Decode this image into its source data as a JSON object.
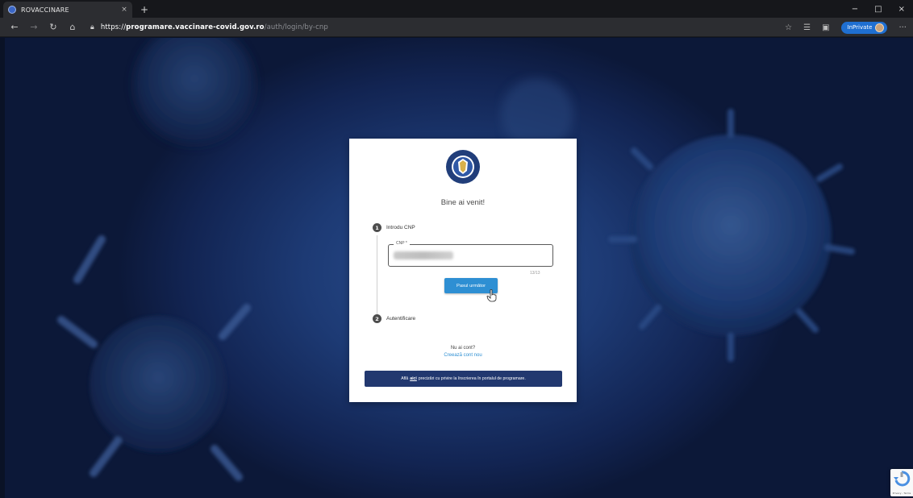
{
  "browser": {
    "tab_title": "ROVACCINARE",
    "tab_close": "×",
    "new_tab": "+",
    "window_controls": [
      "−",
      "□",
      "×"
    ],
    "address": {
      "protocol": "https://",
      "host": "programare.vaccinare-covid.gov.ro",
      "path": "/auth/login/by-cnp"
    },
    "inprivate_label": "InPrivate",
    "more_label": "···"
  },
  "login": {
    "welcome": "Bine ai venit!",
    "step1": {
      "number": "1",
      "label": "Introdu CNP"
    },
    "cnp_field": {
      "label": "CNP *",
      "counter": "13/13"
    },
    "next_button": "Pasul următor",
    "step2": {
      "number": "2",
      "label": "Autentificare"
    },
    "no_account": "Nu ai cont?",
    "create_account": "Creează cont nou",
    "info_bar": {
      "prefix": "Află",
      "link": "aici",
      "suffix": "precizări cu privire la înscrierea în portalul de programare."
    }
  },
  "recaptcha": {
    "text": "Privacy - Terms"
  },
  "colors": {
    "primary_button": "#2e8fd3",
    "info_bar": "#22386f",
    "background": "#1d3a74"
  }
}
